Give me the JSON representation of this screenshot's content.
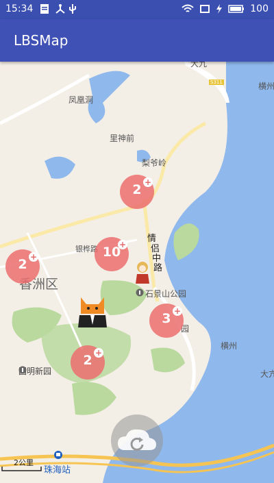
{
  "status": {
    "time": "15:34",
    "battery": "100"
  },
  "appbar": {
    "title": "LBSMap"
  },
  "map": {
    "labels": {
      "fenghuang": "凤凰洞",
      "lishen": "里神前",
      "liyeling": "梨爷岭",
      "yinhua": "银桦路",
      "xiangzhou": "香洲区",
      "qinglv_1": "情",
      "qinglv_2": "侣",
      "qinglv_3": "中",
      "qinglv_4": "路",
      "shijingshan": "石景山公园",
      "hengzhou_top": "横州",
      "hengzhou": "横州",
      "dongao": "大九",
      "dadao": "大亢",
      "yuan": "园",
      "yuanming": "圆明新园",
      "zhuhai": "珠海站",
      "road_s311": "S311",
      "scale": "2公里"
    },
    "clusters": [
      {
        "name": "cluster-north",
        "count": "2"
      },
      {
        "name": "cluster-west",
        "count": "2"
      },
      {
        "name": "cluster-center",
        "count": "10"
      },
      {
        "name": "cluster-east",
        "count": "3"
      },
      {
        "name": "cluster-south",
        "count": "2"
      }
    ]
  },
  "colors": {
    "appbar": "#3f51b5",
    "statusbar": "#3a4fb0",
    "cluster": "#eb6e6e",
    "water": "#8fb8ec",
    "land": "#f4efe6",
    "park": "#b9d99e"
  }
}
